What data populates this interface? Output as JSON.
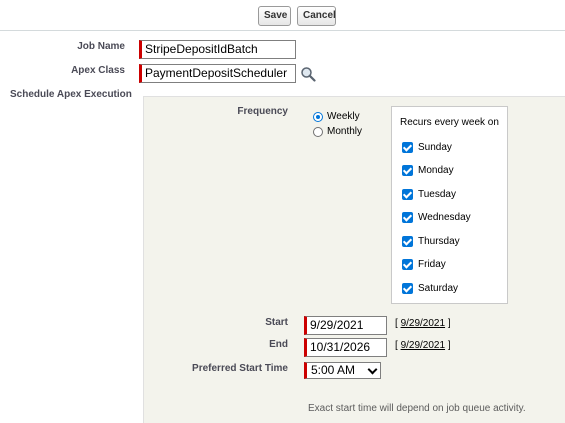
{
  "toolbar": {
    "save_label": "Save",
    "cancel_label": "Cancel"
  },
  "form": {
    "job_name_label": "Job Name",
    "job_name_value": "StripeDepositIdBatch",
    "apex_class_label": "Apex Class",
    "apex_class_value": "PaymentDepositScheduler",
    "lookup_icon": "magnifier-lookup-icon",
    "schedule_label": "Schedule Apex Execution"
  },
  "schedule": {
    "frequency_label": "Frequency",
    "frequency_options": [
      {
        "label": "Weekly",
        "selected": true
      },
      {
        "label": "Monthly",
        "selected": false
      }
    ],
    "recurs_title": "Recurs every week on",
    "days": [
      {
        "label": "Sunday",
        "checked": true
      },
      {
        "label": "Monday",
        "checked": true
      },
      {
        "label": "Tuesday",
        "checked": true
      },
      {
        "label": "Wednesday",
        "checked": true
      },
      {
        "label": "Thursday",
        "checked": true
      },
      {
        "label": "Friday",
        "checked": true
      },
      {
        "label": "Saturday",
        "checked": true
      }
    ],
    "start_label": "Start",
    "start_value": "9/29/2021",
    "start_today_link": "9/29/2021",
    "end_label": "End",
    "end_value": "10/31/2026",
    "end_today_link": "9/29/2021",
    "preferred_time_label": "Preferred Start Time",
    "preferred_time_value": "5:00 AM",
    "note": "Exact start time will depend on job queue activity."
  },
  "colors": {
    "required_marker": "#cc0000",
    "accent": "#0075d9",
    "panel_bg": "#f3f3ec"
  }
}
